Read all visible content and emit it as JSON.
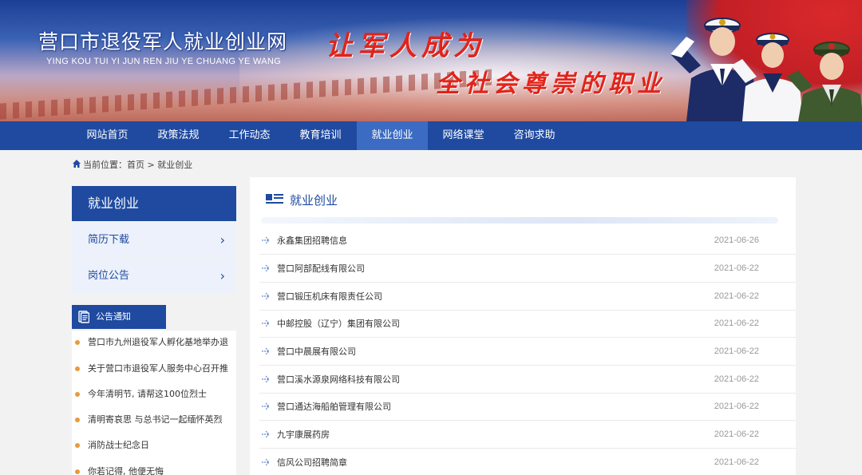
{
  "banner": {
    "site_title": "营口市退役军人就业创业网",
    "site_pinyin": "YING KOU TUI YI JUN REN JIU YE CHUANG YE WANG",
    "slogan_line1": "让军人成为",
    "slogan_line2": "全社会尊崇的职业"
  },
  "nav": {
    "items": [
      {
        "label": "网站首页"
      },
      {
        "label": "政策法规"
      },
      {
        "label": "工作动态"
      },
      {
        "label": "教育培训"
      },
      {
        "label": "就业创业",
        "active": true
      },
      {
        "label": "网络课堂"
      },
      {
        "label": "咨询求助"
      }
    ]
  },
  "breadcrumb": {
    "prefix": "当前位置：",
    "home": "首页",
    "separator": " > ",
    "current": "就业创业"
  },
  "sidebar": {
    "title": "就业创业",
    "items": [
      {
        "label": "简历下载"
      },
      {
        "label": "岗位公告"
      }
    ],
    "notice": {
      "title": "公告通知",
      "items": [
        "营口市九州退役军人孵化基地举办退",
        "关于营口市退役军人服务中心召开推",
        "今年清明节, 请帮这100位烈士",
        "清明寄哀思 与总书记一起缅怀英烈",
        "消防战士纪念日",
        "你若记得, 他便无悔"
      ]
    }
  },
  "main": {
    "title": "就业创业",
    "list": [
      {
        "title": "永鑫集团招聘信息",
        "date": "2021-06-26"
      },
      {
        "title": "营口阿部配线有限公司",
        "date": "2021-06-22"
      },
      {
        "title": "营口锻压机床有限责任公司",
        "date": "2021-06-22"
      },
      {
        "title": "中邮控股（辽宁）集团有限公司",
        "date": "2021-06-22"
      },
      {
        "title": "营口中晨展有限公司",
        "date": "2021-06-22"
      },
      {
        "title": "营口溪水源泉网络科技有限公司",
        "date": "2021-06-22"
      },
      {
        "title": "营口通达海船舶管理有限公司",
        "date": "2021-06-22"
      },
      {
        "title": "九宇康展药房",
        "date": "2021-06-22"
      },
      {
        "title": "信风公司招聘简章",
        "date": "2021-06-22"
      }
    ]
  },
  "colors": {
    "nav_bg": "#1f4aa0",
    "nav_active": "#3c6bc3",
    "slogan": "#e2231a",
    "notice_dot": "#e89a3b"
  }
}
